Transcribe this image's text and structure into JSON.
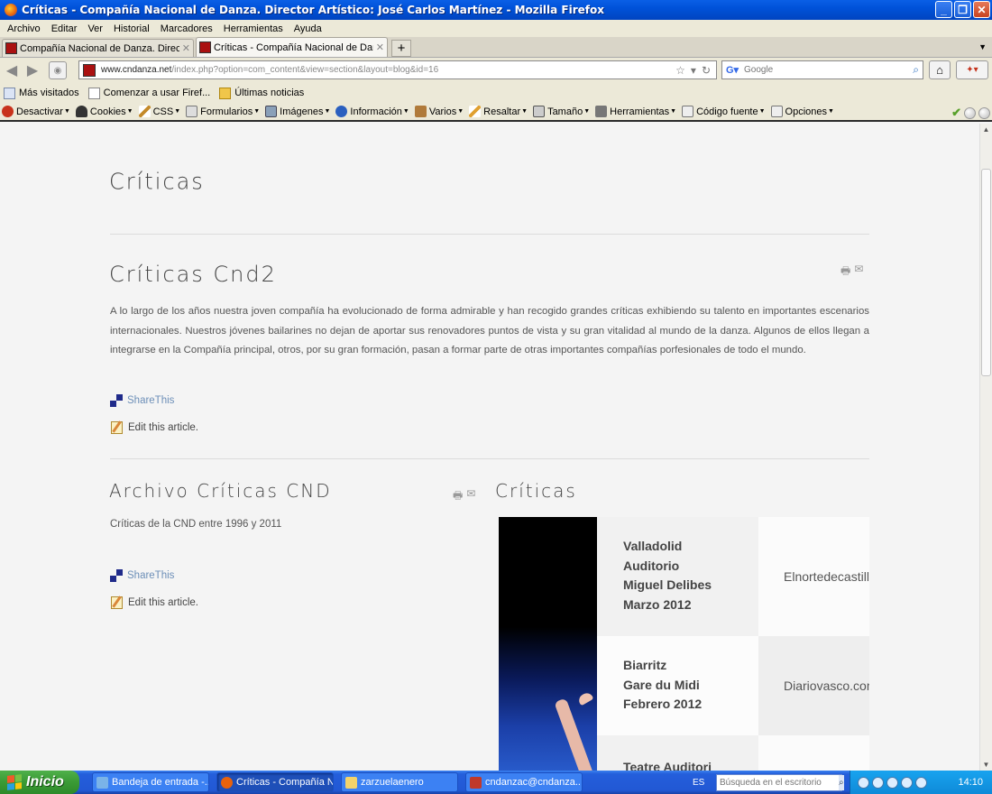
{
  "window": {
    "title": "Críticas - Compañía Nacional de Danza. Director Artístico: José Carlos Martínez - Mozilla Firefox",
    "buttons": {
      "minimize": "_",
      "maximize": "❐",
      "close": "✕"
    }
  },
  "menubar": [
    "Archivo",
    "Editar",
    "Ver",
    "Historial",
    "Marcadores",
    "Herramientas",
    "Ayuda"
  ],
  "tabs": [
    {
      "title": "Compañía Nacional de Danza. Director Ar...",
      "active": false
    },
    {
      "title": "Críticas - Compañía Nacional de Danza. D...",
      "active": true
    }
  ],
  "navbar": {
    "url_domain": "www.cndanza.net",
    "url_path": "/index.php?option=com_content&view=section&layout=blog&id=16",
    "search_placeholder": "Google"
  },
  "bookmarks": [
    "Más visitados",
    "Comenzar a usar Firef...",
    "Últimas noticias"
  ],
  "devbar": [
    "Desactivar",
    "Cookies",
    "CSS",
    "Formularios",
    "Imágenes",
    "Información",
    "Varios",
    "Resaltar",
    "Tamaño",
    "Herramientas",
    "Código fuente",
    "Opciones"
  ],
  "page": {
    "section_title": "Críticas",
    "article1": {
      "title": "Críticas Cnd2",
      "body": "A lo largo de los años nuestra joven compañía ha evolucionado de forma  admirable y han recogido grandes críticas exhibiendo su talento en importantes escenarios internacionales. Nuestros jóvenes bailarines no dejan de aportar sus renovadores puntos de vista y su gran vitalidad al mundo de la danza. Algunos de ellos llegan a integrarse en la Compañía principal, otros, por su gran formación, pasan a formar parte de otras importantes compañías porfesionales de todo el mundo.",
      "share": "ShareThis",
      "edit": "Edit this article."
    },
    "article2": {
      "title": "Archivo Críticas CND",
      "body": "Críticas de la CND entre 1996 y 2011",
      "share": "ShareThis",
      "edit": "Edit this article."
    },
    "criticas_block": {
      "title": "Críticas",
      "rows": [
        {
          "lines": [
            "Valladolid",
            "Auditorio",
            "Miguel Delibes",
            "Marzo 2012"
          ],
          "source": "Elnortedecastilla"
        },
        {
          "lines": [
            "Biarritz",
            "Gare du Midi",
            "Febrero 2012"
          ],
          "source": "Diariovasco.com"
        },
        {
          "lines": [
            "Teatre Auditori"
          ],
          "source": ""
        }
      ]
    }
  },
  "taskbar": {
    "start": "Inicio",
    "tasks": [
      {
        "label": "Bandeja de entrada -...",
        "active": false
      },
      {
        "label": "Críticas - Compañía N...",
        "active": true
      },
      {
        "label": "zarzuelaenero",
        "active": false
      },
      {
        "label": "cndanzac@cndanza....",
        "active": false
      }
    ],
    "lang": "ES",
    "desk_search_placeholder": "Búsqueda en el escritorio",
    "clock": "14:10"
  }
}
